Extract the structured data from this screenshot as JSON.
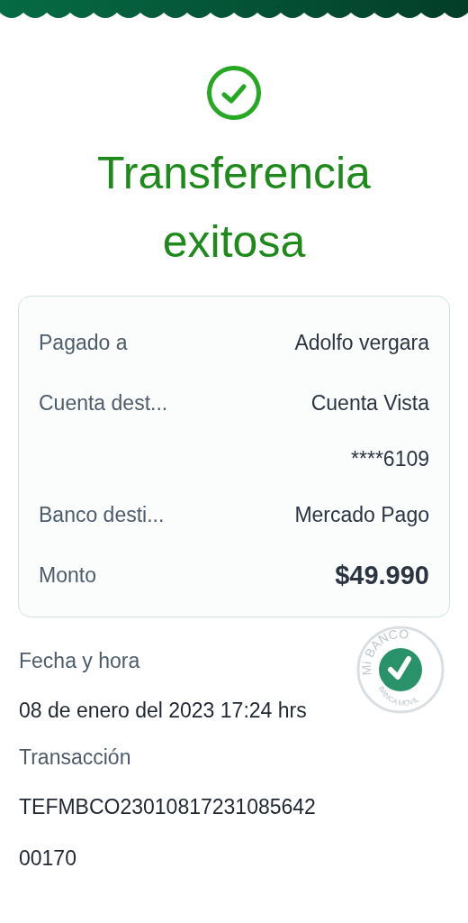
{
  "title": "Transferencia exitosa",
  "details": [
    {
      "label": "Pagado a",
      "values": [
        "Adolfo vergara"
      ],
      "kind": "text"
    },
    {
      "label": "Cuenta dest...",
      "values": [
        "Cuenta Vista",
        "****6109"
      ],
      "kind": "text"
    },
    {
      "label": "Banco desti...",
      "values": [
        "Mercado Pago"
      ],
      "kind": "text"
    },
    {
      "label": "Monto",
      "values": [
        "$49.990"
      ],
      "kind": "amount"
    }
  ],
  "info": [
    {
      "label": "Fecha y hora",
      "values": [
        "08 de enero del 2023 17:24 hrs"
      ]
    },
    {
      "label": "Transacción",
      "values": [
        "TEFMBCO23010817231085642",
        "00170"
      ]
    }
  ],
  "stamp": {
    "top_text": "Mi BANCO",
    "bottom_text": "BANCA MOVIL"
  }
}
